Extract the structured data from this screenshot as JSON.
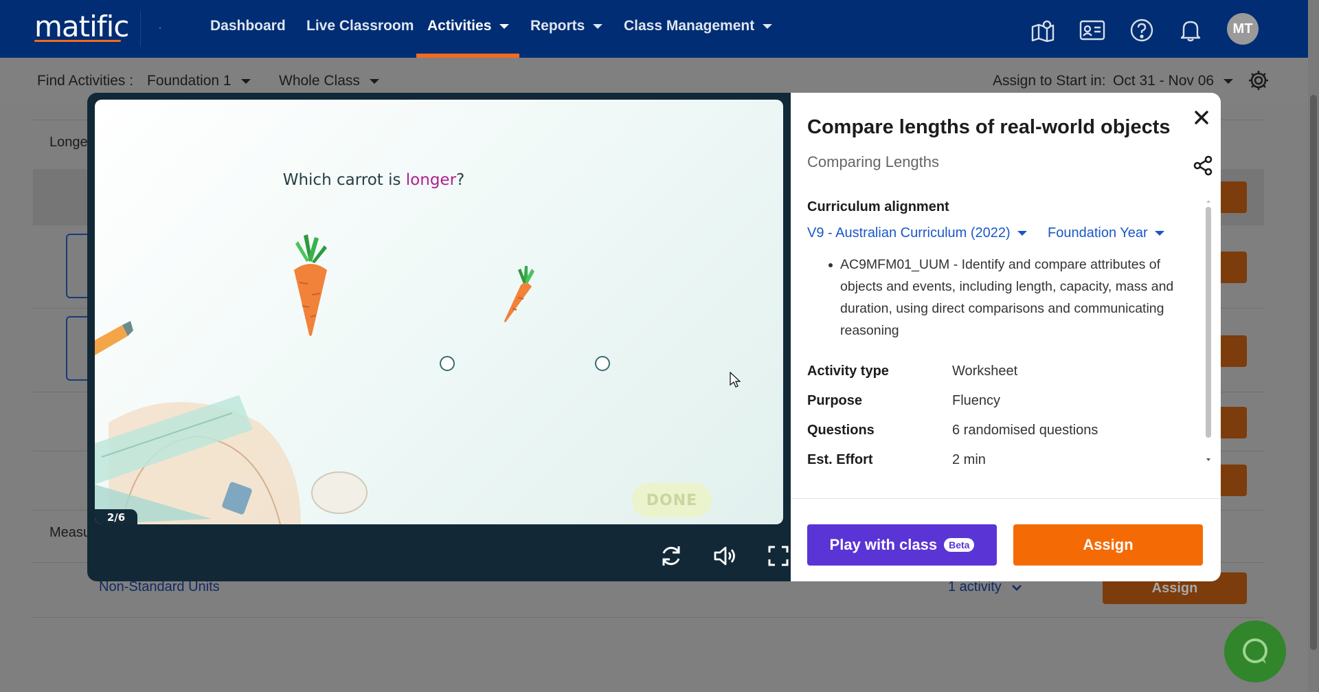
{
  "app": {
    "logo_text": "matific"
  },
  "nav": {
    "items": [
      {
        "label": "Dashboard",
        "has_caret": false
      },
      {
        "label": "Live Classroom",
        "has_caret": false
      },
      {
        "label": "Activities",
        "has_caret": true,
        "active": true
      },
      {
        "label": "Reports",
        "has_caret": true
      },
      {
        "label": "Class Management",
        "has_caret": true
      }
    ],
    "icons": [
      "map-icon",
      "id-card-icon",
      "help-icon",
      "bell-icon"
    ],
    "avatar_initials": "MT"
  },
  "filters": {
    "find_label": "Find Activities :",
    "grade": "Foundation 1",
    "group": "Whole Class",
    "assign_label": "Assign to Start in:",
    "date_range": "Oct 31 - Nov 06"
  },
  "background": {
    "section_label_1": "Longe",
    "section_label_2": "Measu",
    "row_link": "Non-Standard Units",
    "row_activity_count": "1 activity",
    "row_assign": "Assign"
  },
  "game": {
    "question_prefix": "Which carrot is ",
    "question_keyword": "longer",
    "question_suffix": "?",
    "progress": "2/6",
    "done_label": "DONE"
  },
  "activity": {
    "title": "Compare lengths of real-world objects",
    "subtitle": "Comparing Lengths",
    "curriculum_label": "Curriculum alignment",
    "curriculum_select": "V9 - Australian Curriculum (2022)",
    "year_select": "Foundation Year",
    "standard_text": "AC9MFM01_UUM - Identify and compare attributes of objects and events, including length, capacity, mass and duration, using direct comparisons and communicating reasoning",
    "attributes": [
      {
        "key": "Activity type",
        "value": "Worksheet"
      },
      {
        "key": "Purpose",
        "value": "Fluency"
      },
      {
        "key": "Questions",
        "value": "6 randomised questions"
      },
      {
        "key": "Est. Effort",
        "value": "2 min"
      }
    ],
    "play_label": "Play with class",
    "beta_label": "Beta",
    "assign_label": "Assign"
  },
  "colors": {
    "nav_bg": "#002d73",
    "accent_orange": "#f46b06",
    "play_purple": "#5b34d6",
    "link_blue": "#1a57c6",
    "game_frame": "#122837"
  }
}
